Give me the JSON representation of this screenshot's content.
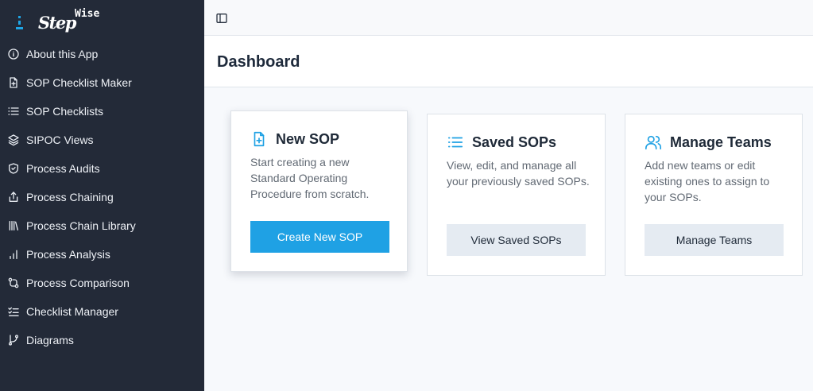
{
  "app": {
    "logo_main": "Step",
    "logo_super": "Wise"
  },
  "sidebar": {
    "items": [
      {
        "label": "About this App",
        "icon": "info-icon"
      },
      {
        "label": "SOP Checklist Maker",
        "icon": "file-plus-icon"
      },
      {
        "label": "SOP Checklists",
        "icon": "list-icon"
      },
      {
        "label": "SIPOC Views",
        "icon": "layers-icon"
      },
      {
        "label": "Process Audits",
        "icon": "shield-check-icon"
      },
      {
        "label": "Process Chaining",
        "icon": "share-icon"
      },
      {
        "label": "Process Chain Library",
        "icon": "library-icon"
      },
      {
        "label": "Process Analysis",
        "icon": "bar-chart-icon"
      },
      {
        "label": "Process Comparison",
        "icon": "git-compare-icon"
      },
      {
        "label": "Checklist Manager",
        "icon": "list-checks-icon"
      },
      {
        "label": "Diagrams",
        "icon": "git-branch-icon"
      }
    ]
  },
  "header": {
    "title": "Dashboard"
  },
  "cards": [
    {
      "title": "New SOP",
      "icon": "file-plus-icon",
      "description": "Start creating a new Standard Operating Procedure from scratch.",
      "button": "Create New SOP"
    },
    {
      "title": "Saved SOPs",
      "icon": "list-icon",
      "description": "View, edit, and manage all your previously saved SOPs.",
      "button": "View Saved SOPs"
    },
    {
      "title": "Manage Teams",
      "icon": "users-icon",
      "description": "Add new teams or edit existing ones to assign to your SOPs.",
      "button": "Manage Teams"
    }
  ],
  "colors": {
    "sidebar_bg": "#232a38",
    "accent": "#1fa1e4",
    "secondary_button": "#e5ebf2"
  }
}
